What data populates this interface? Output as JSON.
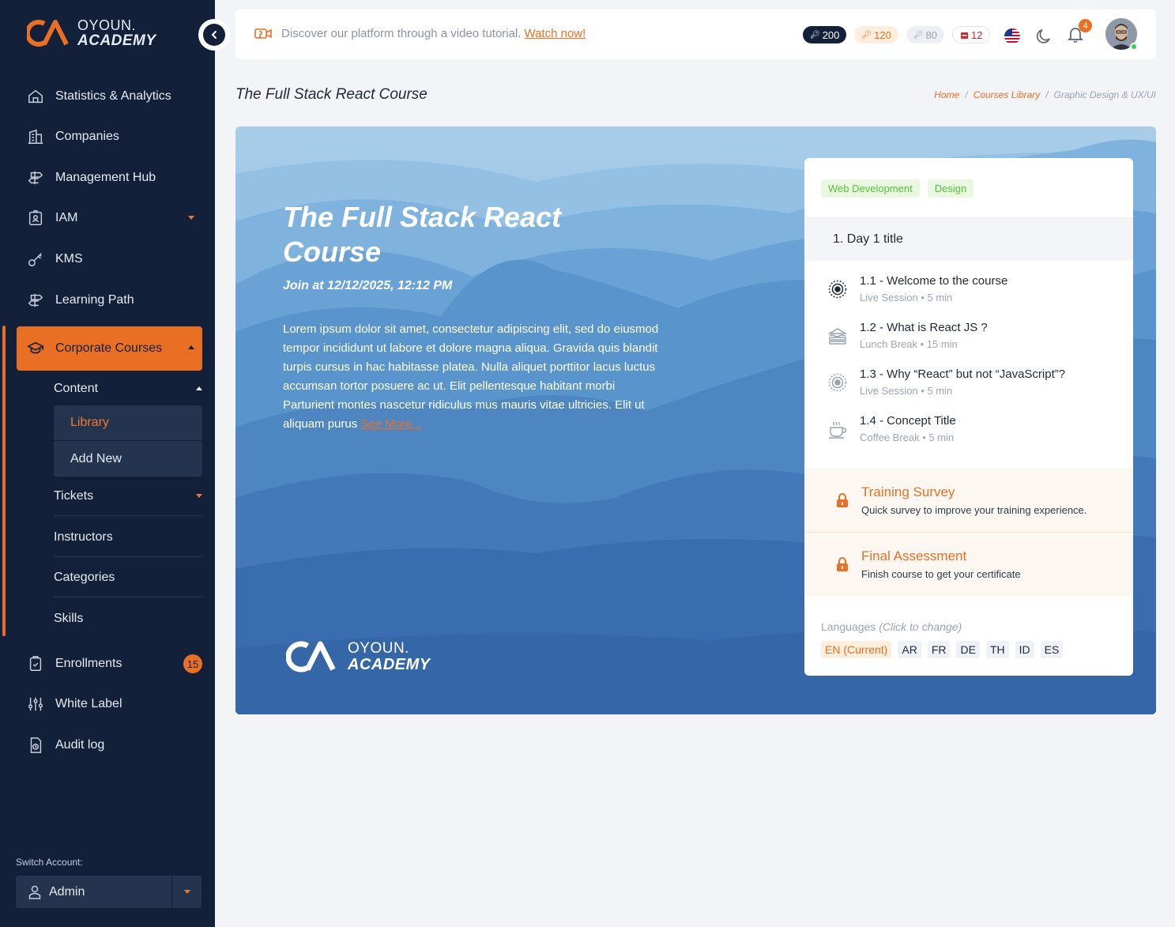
{
  "brand": {
    "line1": "OYOUN.",
    "line2": "ACADEMY",
    "accent": "#E96F24",
    "navy": "#13203A"
  },
  "sidebar": {
    "items": [
      {
        "label": "Statistics & Analytics",
        "icon": "home-icon"
      },
      {
        "label": "Companies",
        "icon": "building-icon"
      },
      {
        "label": "Management Hub",
        "icon": "signpost-icon"
      },
      {
        "label": "IAM",
        "icon": "id-badge-icon"
      },
      {
        "label": "KMS",
        "icon": "key-icon"
      },
      {
        "label": "Learning Path",
        "icon": "signpost-icon"
      }
    ],
    "active": {
      "label": "Corporate Courses",
      "icon": "graduation-cap-icon"
    },
    "submenu": {
      "content": "Content",
      "library": "Library",
      "add_new": "Add New",
      "tickets": "Tickets",
      "instructors": "Instructors",
      "categories": "Categories",
      "skills": "Skills"
    },
    "bottom_items": [
      {
        "label": "Enrollments",
        "icon": "clipboard-check-icon",
        "badge": "15"
      },
      {
        "label": "White Label",
        "icon": "sliders-icon"
      },
      {
        "label": "Audit log",
        "icon": "file-clock-icon"
      }
    ],
    "switch_label": "Switch Account:",
    "account": "Admin"
  },
  "topbar": {
    "promo_text": "Discover our platform through a video tutorial.",
    "promo_link": "Watch now!",
    "pills": {
      "dark": "200",
      "orange": "120",
      "gray": "80",
      "red": "12"
    },
    "notifications": "4"
  },
  "page": {
    "title": "The Full Stack React Course",
    "breadcrumb": {
      "home": "Home",
      "library": "Courses Library",
      "current": "Graphic Design & UX/UI",
      "sep": "/"
    }
  },
  "hero": {
    "title": "The Full Stack React Course",
    "join": "Join at 12/12/2025, 12:12 PM",
    "description": "Lorem ipsum dolor sit amet, consectetur adipiscing elit, sed do eiusmod tempor incididunt ut labore et dolore magna aliqua. Gravida quis blandit turpis cursus in hac habitasse platea. Nulla aliquet porttitor lacus luctus accumsan tortor posuere ac ut. Elit pellentesque habitant morbi Parturient montes nascetur ridiculus mus mauris vitae ultricies. Elit ut aliquam purus",
    "see_more": "See More..."
  },
  "card": {
    "tags": [
      "Web Development",
      "Design"
    ],
    "day": "1.  Day 1 title",
    "lessons": [
      {
        "title": "1.1 - Welcome to the course",
        "meta": "Live Session • 5 min",
        "icon": "live-session-icon"
      },
      {
        "title": "1.2 - What is React JS ?",
        "meta": "Lunch Break • 15 min",
        "icon": "sandwich-icon"
      },
      {
        "title": "1.3 - Why “React” but not “JavaScript”?",
        "meta": "Live Session • 5 min",
        "icon": "live-session-icon"
      },
      {
        "title": "1.4 - Concept Title",
        "meta": "Coffee Break • 5 min",
        "icon": "coffee-cup-icon"
      }
    ],
    "survey": {
      "title": "Training Survey",
      "desc": "Quick survey to improve your training experience."
    },
    "assessment": {
      "title": "Final Assessment",
      "desc": "Finish course to get your certificate"
    },
    "languages_label": "Languages",
    "languages_hint": "(Click to change)",
    "languages": [
      "EN (Current)",
      "AR",
      "FR",
      "DE",
      "TH",
      "ID",
      "ES"
    ]
  }
}
